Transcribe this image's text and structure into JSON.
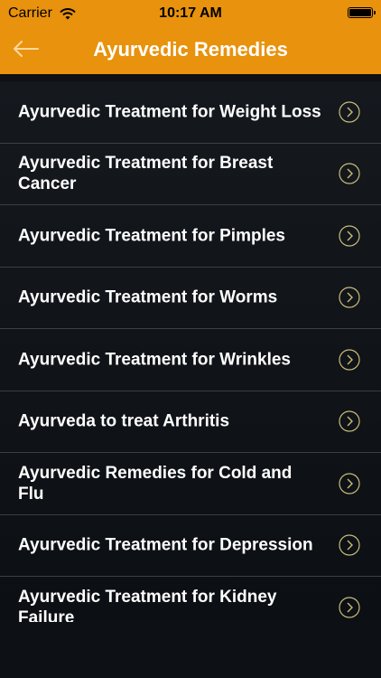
{
  "status": {
    "carrier": "Carrier",
    "time": "10:17 AM"
  },
  "nav": {
    "title": "Ayurvedic Remedies",
    "back_icon": "back-arrow-icon"
  },
  "colors": {
    "header": "#e8920d",
    "background": "#0d1014",
    "accent_chevron": "#c9bd7a"
  },
  "list": {
    "items": [
      {
        "label": "Ayurvedic Treatment for Weight Loss"
      },
      {
        "label": "Ayurvedic Treatment for Breast Cancer"
      },
      {
        "label": "Ayurvedic Treatment for Pimples"
      },
      {
        "label": "Ayurvedic Treatment for Worms"
      },
      {
        "label": "Ayurvedic Treatment for Wrinkles"
      },
      {
        "label": "Ayurveda to treat Arthritis"
      },
      {
        "label": "Ayurvedic Remedies for Cold and Flu"
      },
      {
        "label": "Ayurvedic Treatment for Depression"
      },
      {
        "label": "Ayurvedic Treatment for Kidney Failure"
      }
    ]
  }
}
